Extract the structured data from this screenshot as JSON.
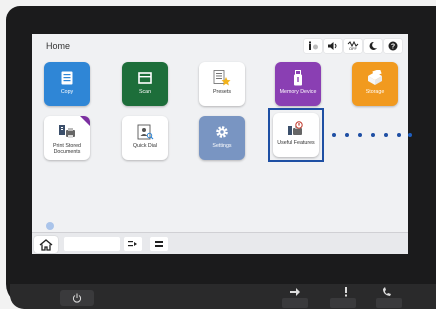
{
  "screen": {
    "title": "Home"
  },
  "status_bar": {
    "icons": [
      "info-icon",
      "volume-icon",
      "wireless-off-icon",
      "moon-icon",
      "help-icon"
    ],
    "wifi_label": "OFF"
  },
  "tiles": {
    "copy": {
      "label": "Copy",
      "icon": "copy-icon"
    },
    "scan": {
      "label": "Scan",
      "icon": "scan-icon"
    },
    "presets": {
      "label": "Presets",
      "icon": "presets-icon"
    },
    "memory_device": {
      "label": "Memory Device",
      "icon": "usb-icon"
    },
    "storage": {
      "label": "Storage",
      "icon": "storage-box-icon"
    },
    "print_stored": {
      "label_line1": "Print Stored",
      "label_line2": "Documents",
      "icon": "print-stored-icon"
    },
    "quick_dial": {
      "label": "Quick Dial",
      "icon": "quick-dial-icon"
    },
    "settings": {
      "label": "Settings",
      "icon": "gear-icon"
    },
    "useful_features": {
      "label": "Useful Features",
      "icon": "useful-features-icon"
    }
  },
  "colors": {
    "copy": "#2f86d6",
    "scan": "#1d6e3a",
    "memory_device": "#8a3fb3",
    "storage": "#f19a1f",
    "settings": "#7995c2",
    "highlight": "#1e4fa3"
  },
  "bottom_bar": {
    "icons": [
      "home-icon",
      "job-status-icon",
      "transmission-icon"
    ]
  },
  "hardware": {
    "icons": [
      "power-icon",
      "data-indicator-icon",
      "alert-icon",
      "fax-indicator-icon"
    ]
  }
}
